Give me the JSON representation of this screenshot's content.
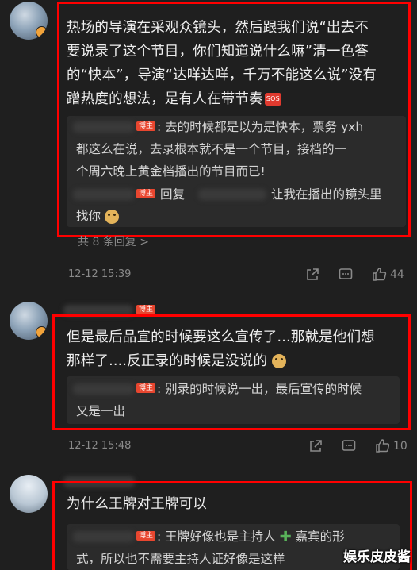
{
  "comments": [
    {
      "text_lines": [
        "热场的导演在采观众镜头，然后跟我们说“出去不",
        "要说录了这个节目，你们知道说什么嘛”清一色答",
        "的“快本”，导演“达咩达咩，千万不能这么说”没有",
        "蹭热度的想法，是有人在带节奏"
      ],
      "emoji_sos": "SOS",
      "replies": [
        {
          "tag": "博主",
          "lines": [
            ": 去的时候都是以为是快本，票务 yxh",
            "都这么在说，去录根本就不是一个节目，接档的一",
            "个周六晚上黄金档播出的节目而已!"
          ]
        },
        {
          "tag": "博主",
          "lines": [
            "回复",
            "让我在播出的镜头里",
            "找你"
          ]
        }
      ],
      "more_replies": "共 8 条回复 >",
      "time": "12-12 15:39",
      "likes": "44"
    },
    {
      "tag": "博主",
      "text_lines": [
        "但是最后品宣的时候要这么宣传了...那就是他们想",
        "那样了....反正录的时候是没说的"
      ],
      "replies": [
        {
          "tag": "博主",
          "lines": [
            ": 别录的时候说一出，最后宣传的时候",
            "又是一出"
          ]
        }
      ],
      "time": "12-12 15:48",
      "likes": "10"
    },
    {
      "text_lines": [
        "为什么王牌对王牌可以"
      ],
      "replies": [
        {
          "tag": "博主",
          "lines": [
            ": 王牌好像也是主持人",
            "嘉宾的形",
            "式，所以也不需要主持人证好像是这样"
          ]
        }
      ]
    }
  ],
  "watermark": "娱乐皮皮酱",
  "colors": {
    "highlight_box": "#ff0000",
    "tag": "#e8462f",
    "background": "#1f1f1f"
  }
}
